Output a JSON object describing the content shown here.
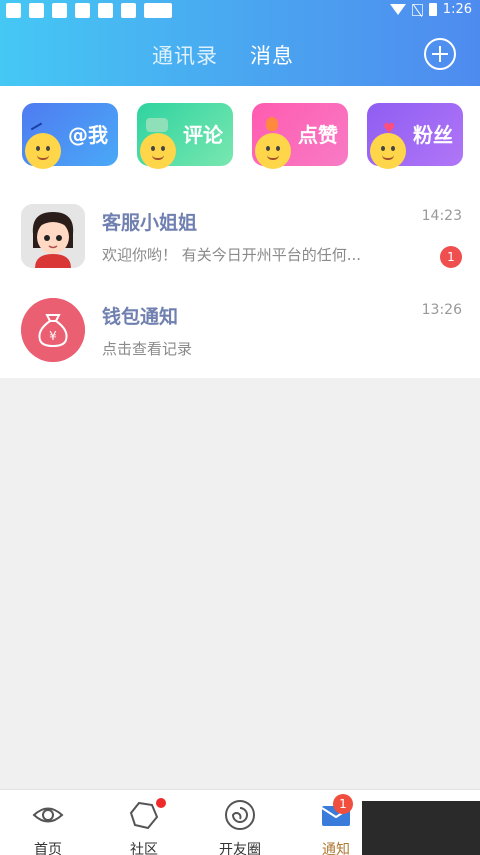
{
  "status_bar": {
    "time": "1:26"
  },
  "header": {
    "tabs": [
      {
        "label": "通讯录",
        "active": false
      },
      {
        "label": "消息",
        "active": true
      }
    ]
  },
  "quick_actions": [
    {
      "label": "@我",
      "icon": "at-me-icon"
    },
    {
      "label": "评论",
      "icon": "comment-icon"
    },
    {
      "label": "点赞",
      "icon": "like-icon"
    },
    {
      "label": "粉丝",
      "icon": "fans-icon"
    }
  ],
  "messages": [
    {
      "title": "客服小姐姐",
      "preview": "欢迎你哟！ 有关今日开州平台的任何...",
      "time": "14:23",
      "unread": "1"
    },
    {
      "title": "钱包通知",
      "preview": "点击查看记录",
      "time": "13:26"
    }
  ],
  "bottom_nav": [
    {
      "label": "首页",
      "icon": "eye-icon"
    },
    {
      "label": "社区",
      "icon": "hexagon-icon",
      "dot": true
    },
    {
      "label": "开友圈",
      "icon": "spiral-icon"
    },
    {
      "label": "通知",
      "icon": "mail-icon",
      "badge": "1",
      "active": true
    }
  ],
  "colors": {
    "header_start": "#45c8f4",
    "header_end": "#4f8bef",
    "title_text": "#7080b0",
    "badge_red": "#f04f4f",
    "active_nav": "#b07a36"
  }
}
